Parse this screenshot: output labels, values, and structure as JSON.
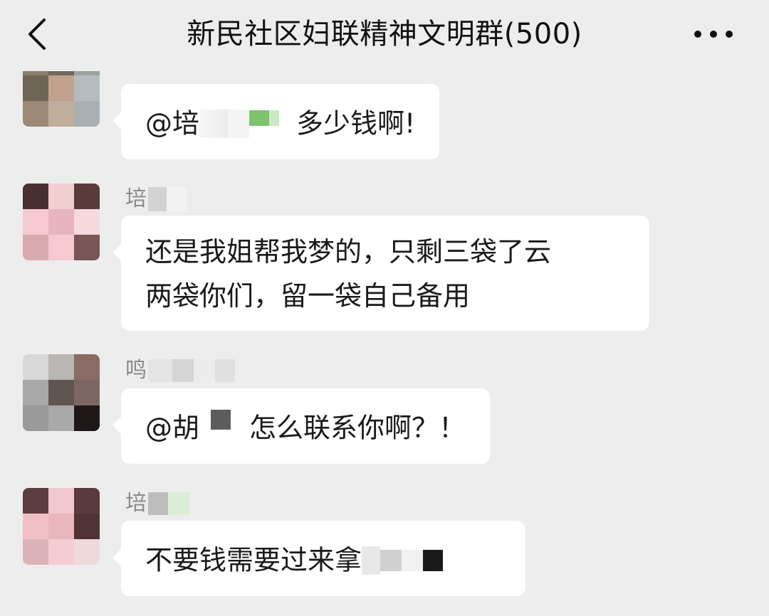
{
  "header": {
    "back_icon": "chevron-left-icon",
    "title": "新民社区妇联精神文明群(500)",
    "more_icon": "more-dots-icon"
  },
  "messages": [
    {
      "sender_visible": "",
      "text_before": "@培",
      "text_after": "多少钱啊!"
    },
    {
      "sender_visible": "培",
      "line1": "还是我姐帮我梦的，只剩三袋了云",
      "line2": "两袋你们，留一袋自己备用"
    },
    {
      "sender_visible": "鸣",
      "text_before": "@胡",
      "text_after": "怎么联系你啊？！"
    },
    {
      "sender_visible": "培",
      "text_before": "不要钱需要过来拿"
    }
  ],
  "colors": {
    "background": "#ededed",
    "bubble": "#ffffff",
    "sender_name": "#8a8a8a",
    "text": "#1a1a1a"
  }
}
